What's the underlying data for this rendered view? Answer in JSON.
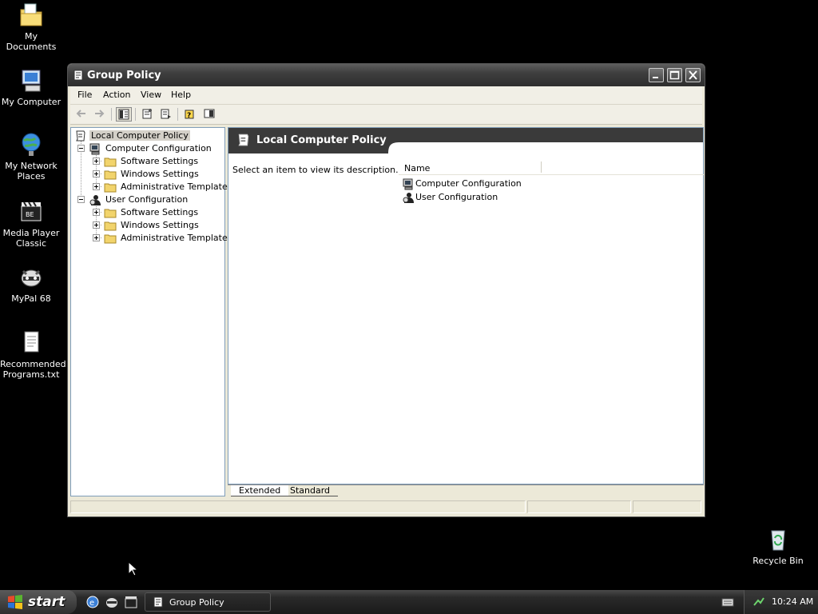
{
  "desktop": {
    "icons": [
      {
        "label": "My Documents"
      },
      {
        "label": "My Computer"
      },
      {
        "label": "My Network Places"
      },
      {
        "label": "Media Player Classic"
      },
      {
        "label": "MyPal 68"
      },
      {
        "label": "Recommended Programs.txt"
      },
      {
        "label": "Recycle Bin"
      }
    ]
  },
  "window": {
    "title": "Group Policy",
    "menu": [
      "File",
      "Action",
      "View",
      "Help"
    ],
    "tree": {
      "root": "Local Computer Policy",
      "computer_config": "Computer Configuration",
      "user_config": "User Configuration",
      "children": [
        "Software Settings",
        "Windows Settings",
        "Administrative Templates"
      ]
    },
    "right_pane": {
      "header": "Local Computer Policy",
      "description": "Select an item to view its description.",
      "column_name": "Name",
      "items": [
        "Computer Configuration",
        "User Configuration"
      ]
    },
    "tabs": [
      "Extended",
      "Standard"
    ]
  },
  "taskbar": {
    "start_label": "start",
    "task_label": "Group Policy",
    "clock": "10:24 AM"
  }
}
